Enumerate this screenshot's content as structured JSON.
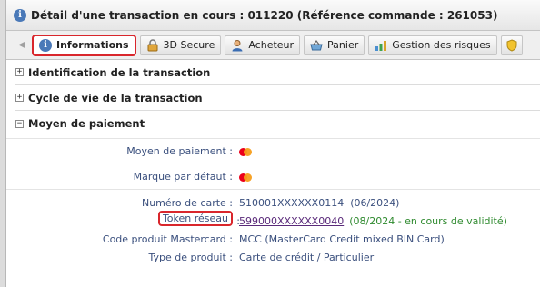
{
  "window": {
    "title": "Détail d'une transaction en cours : 011220 (Référence commande : 261053)"
  },
  "tabs": [
    {
      "label": "Informations",
      "icon": "info-icon",
      "active": true
    },
    {
      "label": "3D Secure",
      "icon": "lock-icon",
      "active": false
    },
    {
      "label": "Acheteur",
      "icon": "user-icon",
      "active": false
    },
    {
      "label": "Panier",
      "icon": "basket-icon",
      "active": false
    },
    {
      "label": "Gestion des risques",
      "icon": "chart-icon",
      "active": false
    }
  ],
  "sections": {
    "identification": {
      "title": "Identification de la transaction",
      "expanded": false
    },
    "cycle": {
      "title": "Cycle de vie de la transaction",
      "expanded": false
    },
    "payment": {
      "title": "Moyen de paiement",
      "expanded": true
    }
  },
  "payment": {
    "moyen_label": "Moyen de paiement :",
    "marque_label": "Marque par défaut :",
    "numero_label": "Numéro de carte :",
    "numero_value": "510001XXXXXX0114  (06/2024)",
    "token_label": "Token réseau",
    "token_colon": ":",
    "token_value": "599000XXXXXX0040",
    "token_validity": "(08/2024 - en cours de validité)",
    "code_label": "Code produit Mastercard :",
    "code_value": "MCC (MasterCard Credit mixed BIN Card)",
    "type_label": "Type de produit :",
    "type_value": "Carte de crédit / Particulier"
  },
  "colors": {
    "highlight": "#d9262c",
    "label": "#3a4f7d",
    "validity": "#2f8a2f"
  }
}
